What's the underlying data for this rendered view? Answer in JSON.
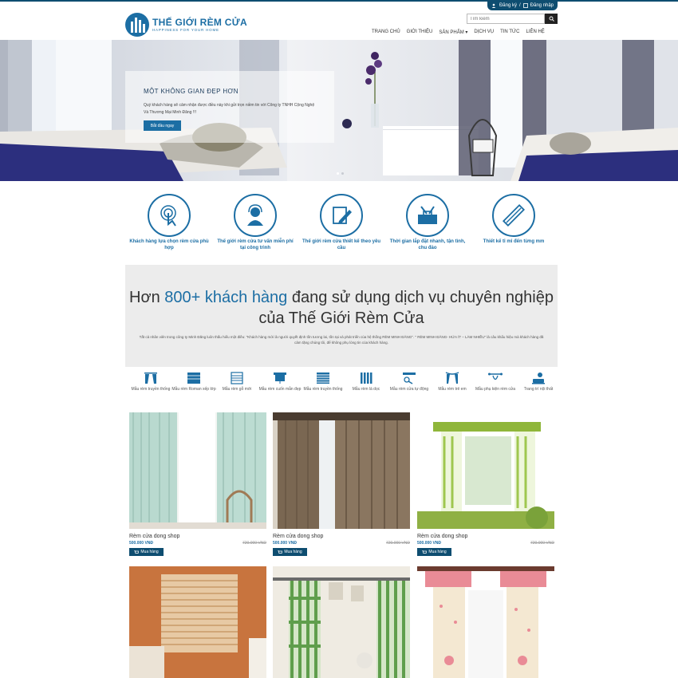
{
  "header": {
    "auth": {
      "register": "Đăng ký",
      "separator": "/",
      "login": "Đăng nhập"
    },
    "logo": {
      "title": "THẾ GIỚI RÈM CỬA",
      "tagline": "HAPPINESS FOR YOUR HOME"
    },
    "search": {
      "placeholder": "Tìm kiếm"
    },
    "nav": [
      "TRANG CHỦ",
      "GIỚI THIỆU",
      "SẢN PHẨM ▾",
      "DỊCH VỤ",
      "TIN TỨC",
      "LIÊN HỆ"
    ]
  },
  "hero": {
    "title": "MỘT KHÔNG GIAN ĐẸP HƠN",
    "description": "Quý khách hàng sẽ cảm nhận được điều này khi gửi trọn niềm tin với Công ty TNHH Cộng Nghệ Và Thương Mại Minh Đăng !!!",
    "button": "Bắt đầu ngay"
  },
  "features": [
    {
      "label": "Khách hàng lựa chọn rèm cửa phù hợp",
      "icon": "touch-icon"
    },
    {
      "label": "Thế giới rèm cửa tư vấn miễn phí tại công trình",
      "icon": "support-agent-icon"
    },
    {
      "label": "Thế giới rèm cửa thiết kế theo yêu cầu",
      "icon": "design-pencil-icon"
    },
    {
      "label": "Thời gian lắp đặt nhanh, tận tình, chu đáo",
      "icon": "toolbox-icon"
    },
    {
      "label": "Thiết kế tỉ mỉ đến từng mm",
      "icon": "ruler-icon"
    }
  ],
  "cta": {
    "heading_pre": "Hơn ",
    "heading_highlight": "800+ khách hàng",
    "heading_post": " đang sử dụng dịch vụ chuyên nghiệp của Thế Giới Rèm Cửa",
    "description": "Tất cả nhân viên trong công ty Minh Đăng luôn thấu hiểu một điều: \"Khách hàng mới là người quyết định tồn tương lai, tồn tại và phát triển của hệ thống RÈM MINH ĐĂNG\". \" RÈM MINH ĐĂNG- HỨA ÍT – LÀM NHIỀU\" là câu khẩu hiệu mà khách hàng đã cảm tặng chúng tôi, để không phụ lòng tin của khách hàng."
  },
  "categories": [
    "Mẫu rèm truyền thống",
    "Mẫu rèm Roman xếp lớp",
    "Mẫu rèm gỗ mới",
    "Mẫu rèm cuốn mẫn đẹp",
    "Mẫu rèm truyền thống",
    "Mẫu rèm lá dọc",
    "Mẫu rèm cửa tự động",
    "Mẫu rèm trẻ em",
    "Mẫu phụ kiện rèm cửa",
    "Trang trí nội thất"
  ],
  "products": [
    {
      "name": "Rèm cửa dong shop",
      "price": "500.000 VNĐ",
      "old_price": "720.000 VNĐ",
      "buy": "Mua hàng"
    },
    {
      "name": "Rèm cửa dong shop",
      "price": "500.000 VNĐ",
      "old_price": "720.000 VNĐ",
      "buy": "Mua hàng"
    },
    {
      "name": "Rèm cửa dong shop",
      "price": "500.000 VNĐ",
      "old_price": "720.000 VNĐ",
      "buy": "Mua hàng"
    }
  ],
  "colors": {
    "brand": "#1c6ea4",
    "dark": "#0e4d70",
    "panel": "#ececec"
  }
}
